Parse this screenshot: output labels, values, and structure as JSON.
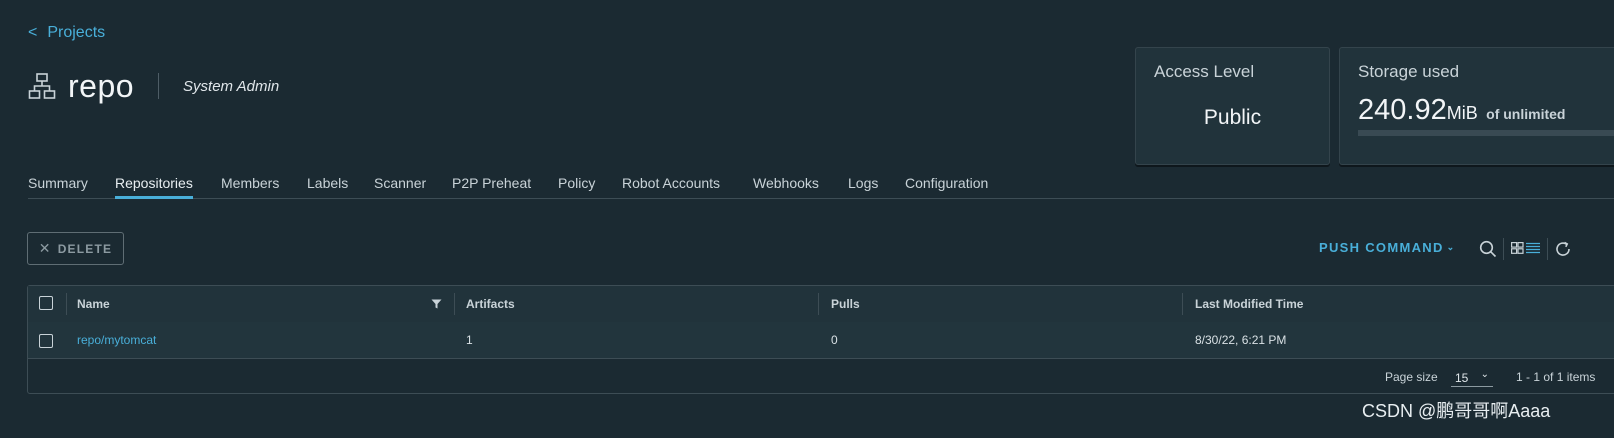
{
  "nav": {
    "back_chevron": "<",
    "back_label": "Projects"
  },
  "project": {
    "icon": "project-tree-icon",
    "name": "repo",
    "role": "System Admin"
  },
  "cards": {
    "access": {
      "title": "Access Level",
      "value": "Public"
    },
    "storage": {
      "title": "Storage used",
      "amount": "240.92",
      "unit": "MiB",
      "of_text": "of unlimited",
      "used_fraction": 0
    }
  },
  "tabs": [
    {
      "label": "Summary",
      "active": false
    },
    {
      "label": "Repositories",
      "active": true
    },
    {
      "label": "Members",
      "active": false
    },
    {
      "label": "Labels",
      "active": false
    },
    {
      "label": "Scanner",
      "active": false
    },
    {
      "label": "P2P Preheat",
      "active": false
    },
    {
      "label": "Policy",
      "active": false
    },
    {
      "label": "Robot Accounts",
      "active": false
    },
    {
      "label": "Webhooks",
      "active": false
    },
    {
      "label": "Logs",
      "active": false
    },
    {
      "label": "Configuration",
      "active": false
    }
  ],
  "toolbar": {
    "delete_label": "DELETE",
    "push_command_label": "PUSH COMMAND",
    "icons": [
      "search-icon",
      "view-toggle-icon",
      "refresh-icon"
    ]
  },
  "table": {
    "columns": [
      "Name",
      "Artifacts",
      "Pulls",
      "Last Modified Time"
    ],
    "rows": [
      {
        "name": "repo/mytomcat",
        "artifacts": "1",
        "pulls": "0",
        "modified": "8/30/22, 6:21 PM"
      }
    ],
    "footer": {
      "page_size_label": "Page size",
      "page_size": "15",
      "range_text": "1 - 1 of 1 items"
    }
  },
  "watermark": "CSDN @鹏哥哥啊Aaaa",
  "colors": {
    "background": "#1b2a32",
    "accent": "#49afd9",
    "card": "#21333b"
  }
}
